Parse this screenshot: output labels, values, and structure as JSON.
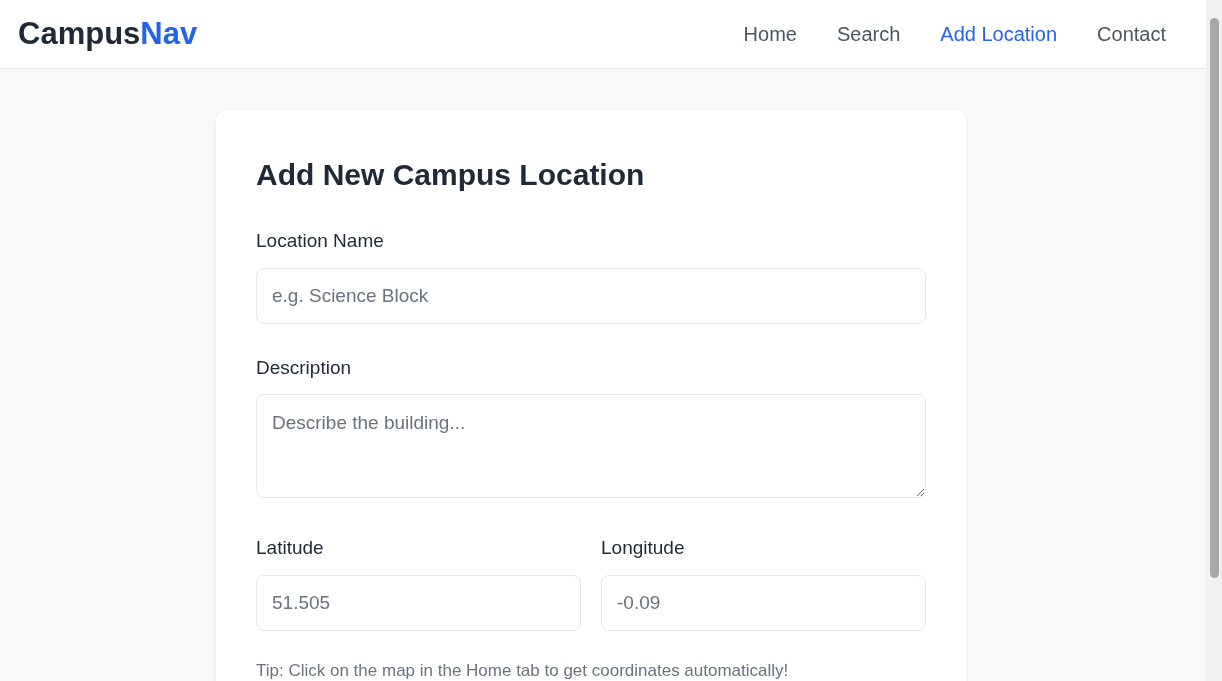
{
  "header": {
    "logo": {
      "text": "Campus",
      "accent": "Nav"
    },
    "nav": [
      {
        "label": "Home",
        "selected": false
      },
      {
        "label": "Search",
        "selected": false
      },
      {
        "label": "Add Location",
        "selected": true
      },
      {
        "label": "Contact",
        "selected": false
      }
    ]
  },
  "form": {
    "title": "Add New Campus Location",
    "name": {
      "label": "Location Name",
      "placeholder": "e.g. Science Block"
    },
    "description": {
      "label": "Description",
      "placeholder": "Describe the building..."
    },
    "latitude": {
      "label": "Latitude",
      "placeholder": "51.505"
    },
    "longitude": {
      "label": "Longitude",
      "placeholder": "-0.09"
    },
    "tip": "Tip: Click on the map in the Home tab to get coordinates automatically!"
  }
}
